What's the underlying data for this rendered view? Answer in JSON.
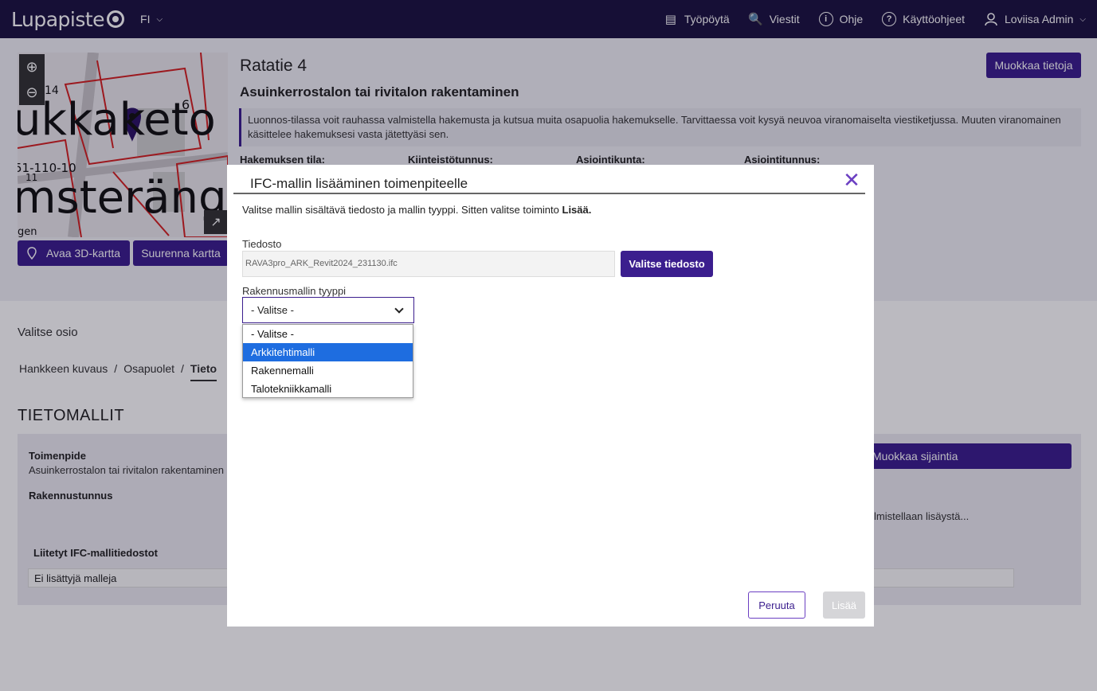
{
  "topbar": {
    "logo": "Lupapiste",
    "lang": "FI",
    "nav": [
      {
        "icon": "document-icon",
        "label": "Työpöytä"
      },
      {
        "icon": "messages-icon",
        "label": "Viestit"
      },
      {
        "icon": "info-icon",
        "label": "Ohje"
      },
      {
        "icon": "help-icon",
        "label": "Käyttöohjeet"
      },
      {
        "icon": "user-icon",
        "label": "Loviisa Admin"
      }
    ]
  },
  "map": {
    "text_big1": "ukkaketo",
    "text_big2": "msterängo",
    "text_small1": "51-110-10",
    "text_small2": "11",
    "text_gen": "gen",
    "num_6": "6",
    "num_14": "14",
    "open_3d": "Avaa 3D-kartta",
    "enlarge": "Suurenna kartta"
  },
  "application": {
    "address": "Ratatie 4",
    "edit_button": "Muokkaa tietoja",
    "title": "Asuinkerrostalon tai rivitalon rakentaminen",
    "notice": "Luonnos-tilassa voit rauhassa valmistella hakemusta ja kutsua muita osapuolia hakemukselle. Tarvittaessa voit kysyä neuvoa viranomaiselta viestiketjussa. Muuten viranomainen käsittelee hakemuksesi vasta jätettyäsi sen.",
    "fields": [
      "Hakemuksen tila:",
      "Kiinteistötunnus:",
      "Asiointikunta:",
      "Asiointitunnus:"
    ]
  },
  "sections": {
    "choose_label": "Valitse osio",
    "crumbs": [
      "Hankkeen kuvaus",
      "Osapuolet",
      "Tieto"
    ],
    "title": "TIETOMALLIT"
  },
  "card": {
    "operation_label": "Toimenpide",
    "operation_value": "Asuinkerrostalon tai rivitalon rakentaminen",
    "building_id_label": "Rakennustunnus",
    "edit_location": "Muokkaa sijaintia",
    "preparing": "lmistellaan lisäystä...",
    "attached_label": "Liitetyt IFC-mallitiedostot",
    "no_models": "Ei lisättyjä malleja"
  },
  "modal": {
    "title": "IFC-mallin lisääminen toimenpiteelle",
    "desc": "Valitse mallin sisältävä tiedosto ja mallin tyyppi. Sitten valitse toiminto ",
    "desc_bold": "Lisää.",
    "file_label": "Tiedosto",
    "file_value": "RAVA3pro_ARK_Revit2024_231130.ifc",
    "choose_file": "Valitse tiedosto",
    "type_label": "Rakennusmallin tyyppi",
    "selected": "- Valitse -",
    "options": [
      "- Valitse -",
      "Arkkitehtimalli",
      "Rakennemalli",
      "Talotekniikkamalli"
    ],
    "highlighted_index": 1,
    "cancel": "Peruuta",
    "add": "Lisää"
  },
  "colors": {
    "topbar": "#1b1240",
    "primary": "#3b1e8e",
    "accent": "#6b3fc2",
    "highlight": "#1e6de0"
  }
}
